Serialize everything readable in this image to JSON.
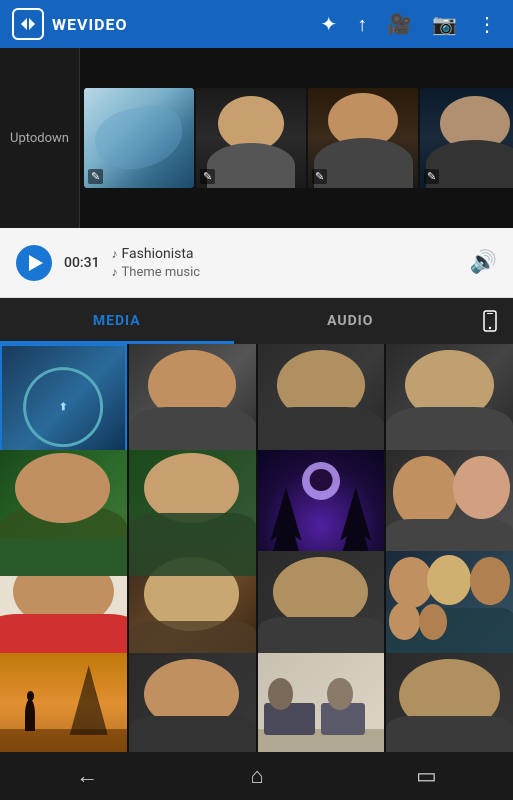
{
  "topbar": {
    "app_name": "WEVIDEO",
    "logo_text": "◁:▷"
  },
  "timeline": {
    "label": "Uptodown",
    "clips": [
      {
        "id": 1,
        "type": "blue-art"
      },
      {
        "id": 2,
        "type": "face"
      },
      {
        "id": 3,
        "type": "face2"
      },
      {
        "id": 4,
        "type": "face3"
      },
      {
        "id": 5,
        "type": "face4"
      }
    ]
  },
  "audio_player": {
    "time": "00:31",
    "title": "Fashionista",
    "subtitle": "Theme music"
  },
  "tabs": {
    "media_label": "MEDIA",
    "audio_label": "AUDIO"
  },
  "bottom_nav": {
    "back_icon": "←",
    "home_icon": "⌂",
    "recent_icon": "▭"
  },
  "grid": {
    "items": [
      {
        "id": 1,
        "type": "circle-logo",
        "selected": true
      },
      {
        "id": 2,
        "type": "face"
      },
      {
        "id": 3,
        "type": "face"
      },
      {
        "id": 4,
        "type": "face"
      },
      {
        "id": 5,
        "type": "face-outdoor"
      },
      {
        "id": 6,
        "type": "face-outdoor"
      },
      {
        "id": 7,
        "type": "fantasy"
      },
      {
        "id": 8,
        "type": "face-couple"
      },
      {
        "id": 9,
        "type": "face-smile"
      },
      {
        "id": 10,
        "type": "face-light"
      },
      {
        "id": 11,
        "type": "face-neutral"
      },
      {
        "id": 12,
        "type": "group"
      },
      {
        "id": 13,
        "type": "desert"
      },
      {
        "id": 14,
        "type": "face-outdoor2"
      },
      {
        "id": 15,
        "type": "office"
      },
      {
        "id": 16,
        "type": "face-close"
      }
    ]
  }
}
